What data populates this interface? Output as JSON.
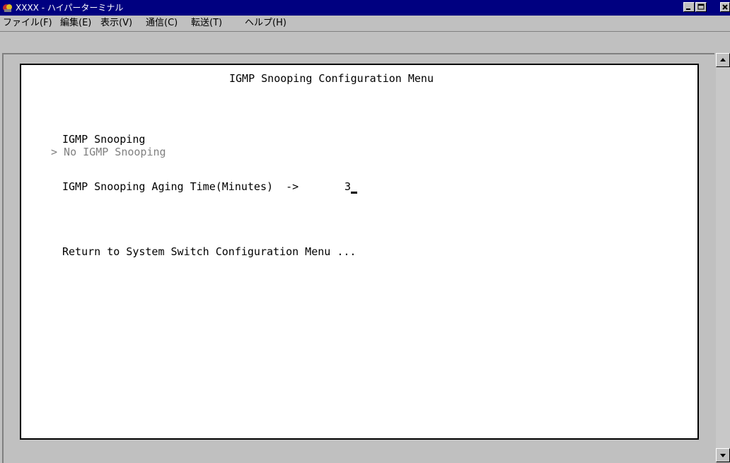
{
  "window": {
    "title": "XXXX - ハイパーターミナル",
    "icon": "hyperterminal-icon",
    "controls": [
      "minimize-icon",
      "maximize-icon",
      "close-icon"
    ]
  },
  "menubar": {
    "items": [
      {
        "label": "ファイル(F)"
      },
      {
        "label": "編集(E)"
      },
      {
        "label": "表示(V)"
      },
      {
        "label": "通信(C)"
      },
      {
        "label": "転送(T)"
      },
      {
        "label": "ヘルプ(H)"
      }
    ]
  },
  "terminal": {
    "menu_title": "IGMP Snooping Configuration Menu",
    "igmp_label": "IGMP Snooping",
    "selected_option": "> No IGMP Snooping",
    "aging_label": "IGMP Snooping Aging Time(Minutes)  ->",
    "aging_value": "3",
    "return_link": "Return to System Switch Configuration Menu ..."
  },
  "colors": {
    "titlebar": "#000080",
    "chrome": "#c0c0c0",
    "screen_bg": "#ffffff",
    "text": "#000000",
    "option_text": "#808080"
  }
}
